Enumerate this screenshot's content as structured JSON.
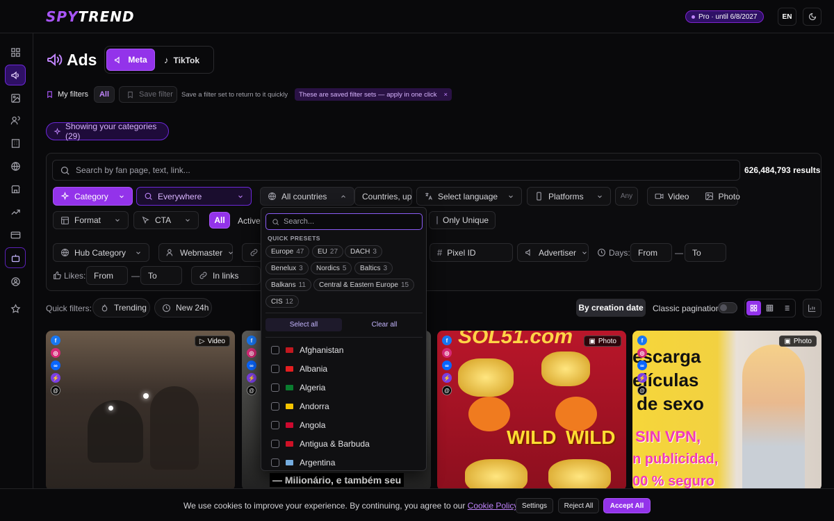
{
  "app": {
    "logo_part1": "SPY",
    "logo_part2": "TREND",
    "pro_badge": "Pro · until 6/8/2027",
    "lang": "EN"
  },
  "sidebar": {
    "items": [
      "dashboard-icon",
      "megaphone-icon",
      "image-icon",
      "users-icon",
      "building-icon",
      "globe-icon",
      "store-icon",
      "trend-icon",
      "card-icon",
      "bot-icon",
      "account-icon",
      "star-icon"
    ]
  },
  "header": {
    "title": "Ads",
    "tabs": [
      {
        "label": "Meta",
        "active": true
      },
      {
        "label": "TikTok",
        "active": false
      }
    ]
  },
  "filters_bar": {
    "my_filters": "My filters",
    "all": "All",
    "save_filter": "Save filter",
    "hint": "Save a filter set to return to it quickly",
    "saved_note": "These are saved filter sets — apply in one click",
    "close": "×"
  },
  "categories_badge": "Showing your categories (29)",
  "search": {
    "placeholder": "Search by fan page, text, link...",
    "results": "626,484,793 results"
  },
  "row1": {
    "category": "Category",
    "everywhere": "Everywhere",
    "all_countries": "All countries",
    "countries_up": "Countries, up",
    "select_language": "Select language",
    "platforms": "Platforms",
    "any": "Any",
    "video": "Video",
    "photo": "Photo"
  },
  "row2": {
    "format": "Format",
    "cta": "CTA",
    "all": "All",
    "active": "Active",
    "only_unique": "Only Unique"
  },
  "row3": {
    "hub_category": "Hub Category",
    "webmaster": "Webmaster",
    "pixel_id": "Pixel ID",
    "advertiser": "Advertiser",
    "days": "Days:",
    "from": "From",
    "dash": "—",
    "to": "To"
  },
  "row4": {
    "likes": "Likes:",
    "from": "From",
    "dash": "—",
    "to": "To",
    "in_links": "In links"
  },
  "countries_dropdown": {
    "search_placeholder": "Search...",
    "presets_label": "QUICK PRESETS",
    "presets": [
      {
        "name": "Europe",
        "count": "47"
      },
      {
        "name": "EU",
        "count": "27"
      },
      {
        "name": "DACH",
        "count": "3"
      },
      {
        "name": "Benelux",
        "count": "3"
      },
      {
        "name": "Nordics",
        "count": "5"
      },
      {
        "name": "Baltics",
        "count": "3"
      },
      {
        "name": "Balkans",
        "count": "11"
      },
      {
        "name": "Central & Eastern Europe",
        "count": "15"
      },
      {
        "name": "CIS",
        "count": "12"
      }
    ],
    "select_all": "Select all",
    "clear_all": "Clear all",
    "countries": [
      "Afghanistan",
      "Albania",
      "Algeria",
      "Andorra",
      "Angola",
      "Antigua & Barbuda",
      "Argentina"
    ],
    "flag_colors": [
      "#c2181f",
      "#e41e20",
      "#0a7c2f",
      "#f5c400",
      "#cc092f",
      "#ce1126",
      "#74acdf"
    ]
  },
  "quick_filters": {
    "label": "Quick filters:",
    "trending": "Trending",
    "new24": "New 24h"
  },
  "sort": {
    "by_creation": "By creation date",
    "classic": "Classic pagination"
  },
  "cards": [
    {
      "tag": "Video",
      "caption": ""
    },
    {
      "tag": "",
      "caption": "— Milionário, e também seu"
    },
    {
      "tag": "Photo",
      "caption": "",
      "top_text": "SOL51.com",
      "wild": "WILD"
    },
    {
      "tag": "Photo",
      "caption": "",
      "lines": [
        "escarga",
        "elículas",
        "de sexo",
        "SIN VPN,",
        "n publicidad,",
        "00 % seguro"
      ]
    }
  ],
  "cookie": {
    "text": "We use cookies to improve your experience. By continuing, you agree to our ",
    "link": "Cookie Policy",
    "period": ".",
    "settings": "Settings",
    "reject": "Reject All",
    "accept": "Accept All"
  },
  "colors": {
    "accent": "#9333ea",
    "bg": "#09090b"
  }
}
